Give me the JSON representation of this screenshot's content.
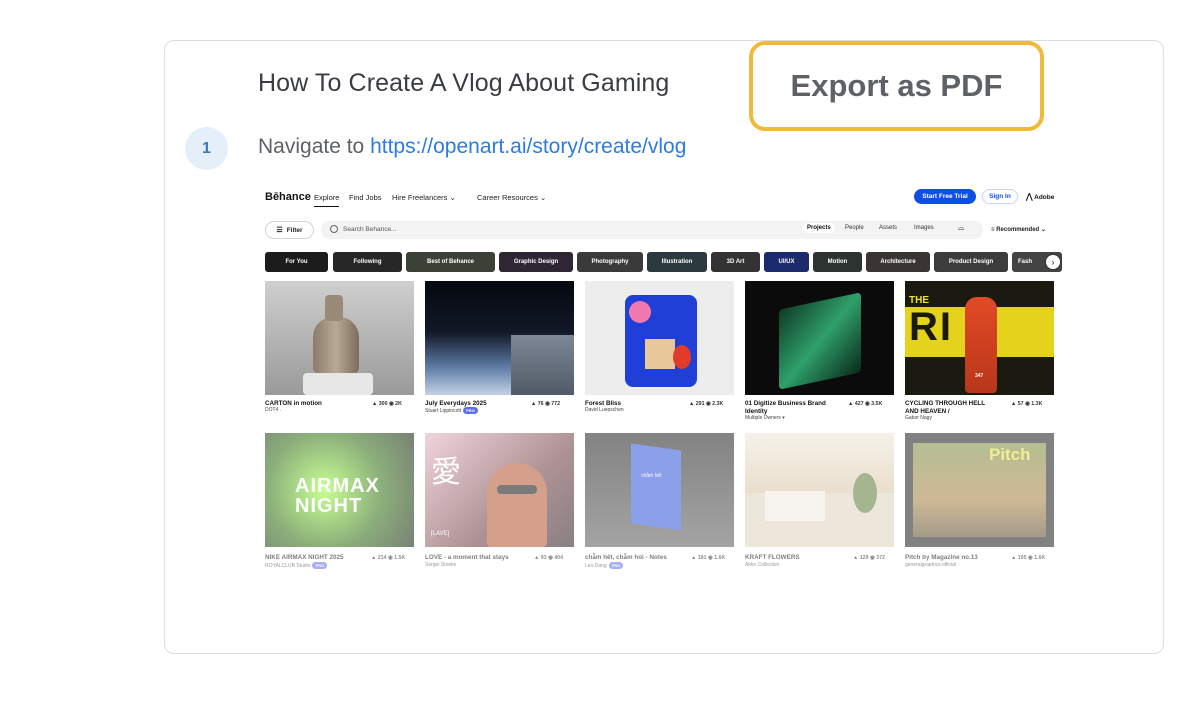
{
  "guide": {
    "title": "How To Create A Vlog About Gaming",
    "export_label": "Export as PDF",
    "step": {
      "number": "1",
      "prefix": "Navigate to ",
      "url": "https://openart.ai/story/create/vlog"
    }
  },
  "behance": {
    "logo": "Bēhance",
    "nav": [
      "Explore",
      "Find Jobs",
      "Hire Freelancers ⌄",
      "Career Resources ⌄"
    ],
    "trial_label": "Start Free Trial",
    "signin_label": "Sign In",
    "adobe_label": "Adobe",
    "filter_label": "Filter",
    "search_placeholder": "Search Behance...",
    "segments": [
      "Projects",
      "People",
      "Assets",
      "Images"
    ],
    "sort_label": "Recommended",
    "categories": [
      "For You",
      "Following",
      "Best of Behance",
      "Graphic Design",
      "Photography",
      "Illustration",
      "3D Art",
      "UI/UX",
      "Motion",
      "Architecture",
      "Product Design",
      "Fash"
    ],
    "projects": [
      {
        "title": "CARTON in motion",
        "owner": "DOT4 .",
        "likes": "300",
        "views": "2K"
      },
      {
        "title": "July Everydays 2025",
        "owner": "Stuart Lippincott",
        "pro": "PRO",
        "likes": "76",
        "views": "772"
      },
      {
        "title": "Forest Bliss",
        "owner": "David Luepschen",
        "likes": "291",
        "views": "2.3K"
      },
      {
        "title": "01 Digitize Business Brand Identity",
        "owner": "Multiple Owners ▾",
        "likes": "427",
        "views": "3.5K"
      },
      {
        "title": "CYCLING THROUGH HELL AND HEAVEN /",
        "owner": "Gabor Nagy",
        "likes": "57",
        "views": "1.3K"
      },
      {
        "title": "NIKE AIRMAX NIGHT 2025",
        "owner": "ROYALCLUB Studio",
        "pro": "PRO",
        "likes": "214",
        "views": "1.5K"
      },
      {
        "title": "LOVE - a moment that stays",
        "owner": "Sergei Stoeke",
        "likes": "93",
        "views": "404"
      },
      {
        "title": "chẵm hết, chẵm hỏi - Notes",
        "owner": "Leo Dang",
        "pro": "PRO",
        "likes": "181",
        "views": "1.6K"
      },
      {
        "title": "KRAFT FLOWERS",
        "owner": "Akko Collective",
        "likes": "129",
        "views": "372"
      },
      {
        "title": "Pitch by Magazine no.13",
        "owner": "generalgraphics.official",
        "likes": "195",
        "views": "1.6K"
      }
    ],
    "tile_text": {
      "airmax": "AIRMAX",
      "night": "NIGHT",
      "pitch": "Pitch",
      "the": "THE",
      "rift": "RI  T",
      "bib": "347",
      "book": "chẵm hết",
      "love_char": "愛",
      "love_tag": "[LAVE]"
    }
  }
}
